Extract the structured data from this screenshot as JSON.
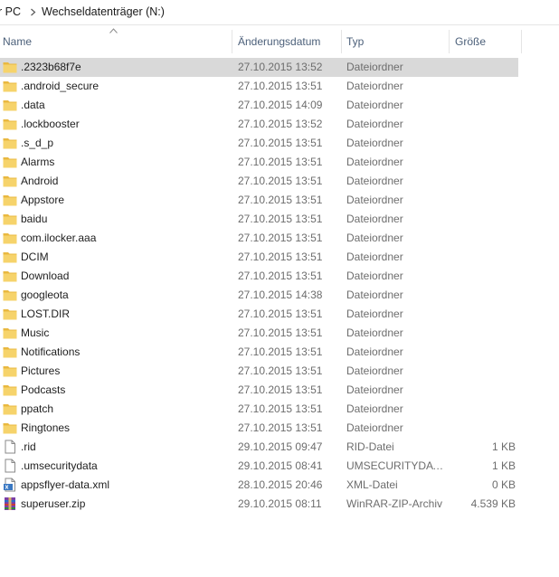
{
  "breadcrumb": {
    "pc": "r PC",
    "drive": "Wechseldatenträger (N:)"
  },
  "columns": {
    "name": "Name",
    "date": "Änderungsdatum",
    "type": "Typ",
    "size": "Größe"
  },
  "colors": {
    "folder": "#f6d36b",
    "selection": "#d9d9d9",
    "header_text": "#4c607a"
  },
  "files": [
    {
      "name": ".2323b68f7e",
      "date": "27.10.2015 13:52",
      "type": "Dateiordner",
      "size": "",
      "icon": "folder-icon",
      "selected": true
    },
    {
      "name": ".android_secure",
      "date": "27.10.2015 13:51",
      "type": "Dateiordner",
      "size": "",
      "icon": "folder-icon"
    },
    {
      "name": ".data",
      "date": "27.10.2015 14:09",
      "type": "Dateiordner",
      "size": "",
      "icon": "folder-icon"
    },
    {
      "name": ".lockbooster",
      "date": "27.10.2015 13:52",
      "type": "Dateiordner",
      "size": "",
      "icon": "folder-icon"
    },
    {
      "name": ".s_d_p",
      "date": "27.10.2015 13:51",
      "type": "Dateiordner",
      "size": "",
      "icon": "folder-icon"
    },
    {
      "name": "Alarms",
      "date": "27.10.2015 13:51",
      "type": "Dateiordner",
      "size": "",
      "icon": "folder-icon"
    },
    {
      "name": "Android",
      "date": "27.10.2015 13:51",
      "type": "Dateiordner",
      "size": "",
      "icon": "folder-icon"
    },
    {
      "name": "Appstore",
      "date": "27.10.2015 13:51",
      "type": "Dateiordner",
      "size": "",
      "icon": "folder-icon"
    },
    {
      "name": "baidu",
      "date": "27.10.2015 13:51",
      "type": "Dateiordner",
      "size": "",
      "icon": "folder-icon"
    },
    {
      "name": "com.ilocker.aaa",
      "date": "27.10.2015 13:51",
      "type": "Dateiordner",
      "size": "",
      "icon": "folder-icon"
    },
    {
      "name": "DCIM",
      "date": "27.10.2015 13:51",
      "type": "Dateiordner",
      "size": "",
      "icon": "folder-icon"
    },
    {
      "name": "Download",
      "date": "27.10.2015 13:51",
      "type": "Dateiordner",
      "size": "",
      "icon": "folder-icon"
    },
    {
      "name": "googleota",
      "date": "27.10.2015 14:38",
      "type": "Dateiordner",
      "size": "",
      "icon": "folder-icon"
    },
    {
      "name": "LOST.DIR",
      "date": "27.10.2015 13:51",
      "type": "Dateiordner",
      "size": "",
      "icon": "folder-icon"
    },
    {
      "name": "Music",
      "date": "27.10.2015 13:51",
      "type": "Dateiordner",
      "size": "",
      "icon": "folder-icon"
    },
    {
      "name": "Notifications",
      "date": "27.10.2015 13:51",
      "type": "Dateiordner",
      "size": "",
      "icon": "folder-icon"
    },
    {
      "name": "Pictures",
      "date": "27.10.2015 13:51",
      "type": "Dateiordner",
      "size": "",
      "icon": "folder-icon"
    },
    {
      "name": "Podcasts",
      "date": "27.10.2015 13:51",
      "type": "Dateiordner",
      "size": "",
      "icon": "folder-icon"
    },
    {
      "name": "ppatch",
      "date": "27.10.2015 13:51",
      "type": "Dateiordner",
      "size": "",
      "icon": "folder-icon"
    },
    {
      "name": "Ringtones",
      "date": "27.10.2015 13:51",
      "type": "Dateiordner",
      "size": "",
      "icon": "folder-icon"
    },
    {
      "name": ".rid",
      "date": "29.10.2015 09:47",
      "type": "RID-Datei",
      "size": "1 KB",
      "icon": "file-icon"
    },
    {
      "name": ".umsecuritydata",
      "date": "29.10.2015 08:41",
      "type": "UMSECURITYDAT...",
      "size": "1 KB",
      "icon": "file-icon"
    },
    {
      "name": "appsflyer-data.xml",
      "date": "28.10.2015 20:46",
      "type": "XML-Datei",
      "size": "0 KB",
      "icon": "xml-file-icon"
    },
    {
      "name": "superuser.zip",
      "date": "29.10.2015 08:11",
      "type": "WinRAR-ZIP-Archiv",
      "size": "4.539 KB",
      "icon": "winrar-archive-icon"
    }
  ]
}
